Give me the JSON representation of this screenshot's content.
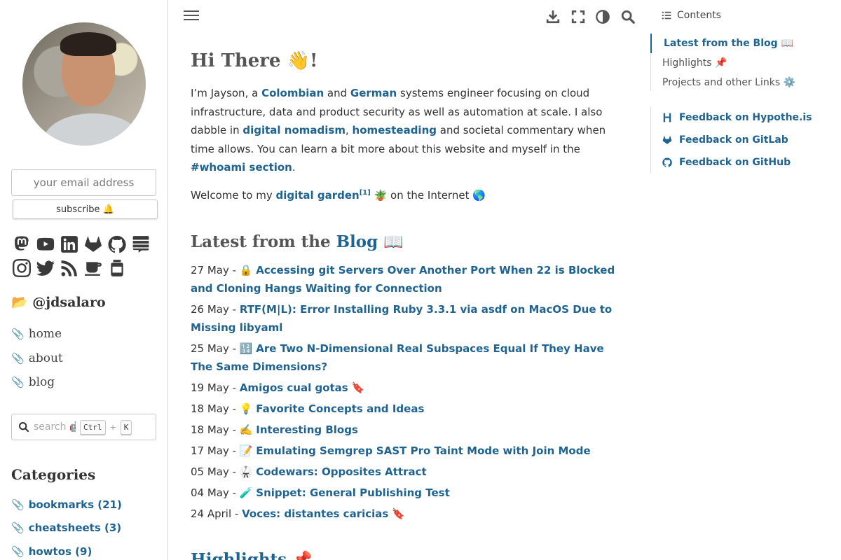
{
  "sidebar": {
    "email_placeholder": "your email address",
    "subscribe_label": "subscribe 🔔",
    "social_icons": [
      "mastodon-icon",
      "youtube-icon",
      "linkedin-icon",
      "gitlab-icon",
      "github-icon",
      "stackexchange-icon",
      "instagram-icon",
      "twitter-icon",
      "rss-icon",
      "coffee-icon",
      "jar-icon"
    ],
    "handle": "📂 @jdsalaro",
    "nav": [
      {
        "icon": "📎",
        "label": "home"
      },
      {
        "icon": "📎",
        "label": "about"
      },
      {
        "icon": "📎",
        "label": "blog"
      }
    ],
    "search_placeholder": "search 🤖",
    "search_key1": "Ctrl",
    "search_plus": "+",
    "search_key2": "K",
    "categories_title": "Categories",
    "categories": [
      {
        "icon": "📎",
        "label": "bookmarks (21)"
      },
      {
        "icon": "📎",
        "label": "cheatsheets (3)"
      },
      {
        "icon": "📎",
        "label": "howtos (9)"
      }
    ]
  },
  "main": {
    "greeting": "Hi There 👋!",
    "intro": {
      "t1": "I’m Jayson, a ",
      "l1": "Colombian",
      "t2": " and ",
      "l2": "German",
      "t3": " systems engineer focusing on cloud infrastructure, data and product security as well as automation at scale. I also dabble in ",
      "l3": "digital nomadism",
      "t4": ", ",
      "l4": "homesteading",
      "t5": " and societal commentary when time allows. You can learn a bit more about this website and myself in the ",
      "l5": "#whoami section",
      "t6": "."
    },
    "welcome": {
      "t1": "Welcome to my ",
      "l1": "digital garden",
      "sup": "[1]",
      "t2": " 🪴 on the Internet 🌎"
    },
    "blog_heading_prefix": "Latest from the ",
    "blog_heading_link": "Blog",
    "blog_heading_suffix": " 📖",
    "posts": [
      {
        "date": "27 May - ",
        "emoji": "🔒 ",
        "title": "Accessing git Servers Over Another Port When 22 is Blocked and Cloning Hangs Waiting for Connection",
        "after": ""
      },
      {
        "date": "26 May - ",
        "emoji": "",
        "title": "RTF(M|L): Error Installing Ruby 3.3.1 via asdf on MacOS Due to Missing libyaml",
        "after": ""
      },
      {
        "date": "25 May - ",
        "emoji": "🔢 ",
        "title": "Are Two N-Dimensional Real Subspaces Equal If They Have The Same Dimensions?",
        "after": ""
      },
      {
        "date": "19 May - ",
        "emoji": "",
        "title": "Amigos cual gotas",
        "after": " 🔖"
      },
      {
        "date": "18 May - ",
        "emoji": "💡 ",
        "title": "Favorite Concepts and Ideas",
        "after": ""
      },
      {
        "date": "18 May - ",
        "emoji": "✍️ ",
        "title": "Interesting Blogs",
        "after": ""
      },
      {
        "date": "17 May - ",
        "emoji": "📝 ",
        "title": "Emulating Semgrep SAST Pro Taint Mode with Join Mode",
        "after": ""
      },
      {
        "date": "05 May - ",
        "emoji": "🥋 ",
        "title": "Codewars: Opposites Attract",
        "after": ""
      },
      {
        "date": "04 May - ",
        "emoji": "🧪 ",
        "title": "Snippet: General Publishing Test",
        "after": ""
      },
      {
        "date": "24 April - ",
        "emoji": "",
        "title": "Voces: distantes caricias",
        "after": " 🔖"
      }
    ],
    "next_heading": "Highlights 📌"
  },
  "toc": {
    "title": "Contents",
    "items": [
      {
        "label": "Latest from the Blog 📖",
        "active": true
      },
      {
        "label": "Highlights 📌",
        "active": false
      },
      {
        "label": "Projects and other Links ⚙️",
        "active": false
      }
    ],
    "feedback": [
      {
        "icon": "hypothesis-icon",
        "label": "Feedback on Hypothe.is"
      },
      {
        "icon": "gitlab-icon",
        "label": "Feedback on GitLab"
      },
      {
        "icon": "github-icon",
        "label": "Feedback on GitHub"
      }
    ]
  },
  "toolbar": {
    "icons": [
      "download-icon",
      "fullscreen-icon",
      "theme-toggle-icon",
      "search-icon"
    ]
  },
  "colors": {
    "link": "#1f6391",
    "heading": "#555555",
    "border": "#d6d6d6"
  }
}
